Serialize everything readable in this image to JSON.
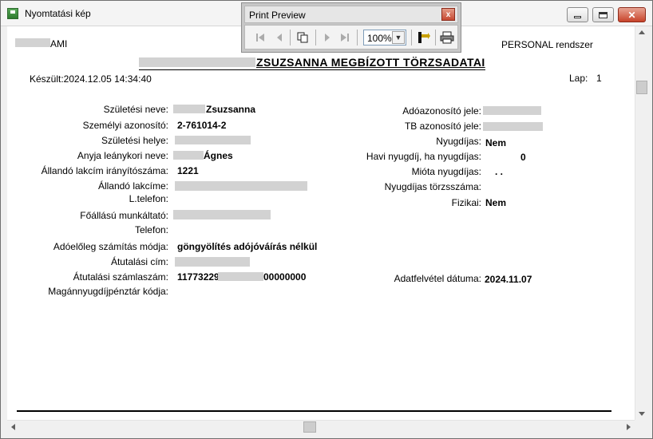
{
  "window": {
    "title": "Nyomtatási kép"
  },
  "print_preview": {
    "title": "Print Preview",
    "zoom": "100%",
    "buttons": [
      "first-page-icon",
      "prev-page-icon",
      "copy-icon",
      "next-page-icon",
      "last-page-icon",
      "export-icon",
      "print-icon"
    ]
  },
  "report": {
    "company": "AMI",
    "system": "PERSONAL rendszer",
    "title": "ZSUZSANNA MEGBÍZOTT TÖRZSADATAI",
    "created": "Készült:2024.12.05 14:34:40",
    "page_label": "Lap:",
    "page_number": "1"
  },
  "left_fields": [
    {
      "label": "Születési neve:",
      "value": "Zsuzsanna"
    },
    {
      "label": "Személyi azonosító:",
      "value": "2-761014-2"
    },
    {
      "label": "Születési helye:",
      "value": ""
    },
    {
      "label": "Anyja leánykori neve:",
      "value": "Ágnes"
    },
    {
      "label": "Állandó lakcím irányítószáma:",
      "value": "1221"
    },
    {
      "label": "Állandó lakcíme:",
      "value": ""
    },
    {
      "label": "L.telefon:",
      "value": ""
    },
    {
      "label": "Főállású munkáltató:",
      "value": ""
    },
    {
      "label": "Telefon:",
      "value": ""
    },
    {
      "label": "Adóelőleg számítás módja:",
      "value": "göngyölítés adójóváírás nélkül"
    },
    {
      "label": "Átutalási cím:",
      "value": ""
    },
    {
      "label": "Átutalási számlaszám:",
      "value": "11773229",
      "value_suffix": "00000000"
    },
    {
      "label": "Magánnyugdíjpénztár kódja:",
      "value": ""
    }
  ],
  "right_fields": [
    {
      "label": "Adóazonosító jele:",
      "value": ""
    },
    {
      "label": "TB azonosító jele:",
      "value": ""
    },
    {
      "label": "Nyugdíjas:",
      "value": "Nem"
    },
    {
      "label": "Havi nyugdíj, ha nyugdíjas:",
      "value": "0"
    },
    {
      "label": "Mióta nyugdíjas:",
      "value": ". ."
    },
    {
      "label": "Nyugdíjas törzsszáma:",
      "value": ""
    },
    {
      "label": "Fizikai:",
      "value": "Nem"
    },
    {
      "label": "Adatfelvétel dátuma:",
      "value": "2024.11.07"
    }
  ]
}
